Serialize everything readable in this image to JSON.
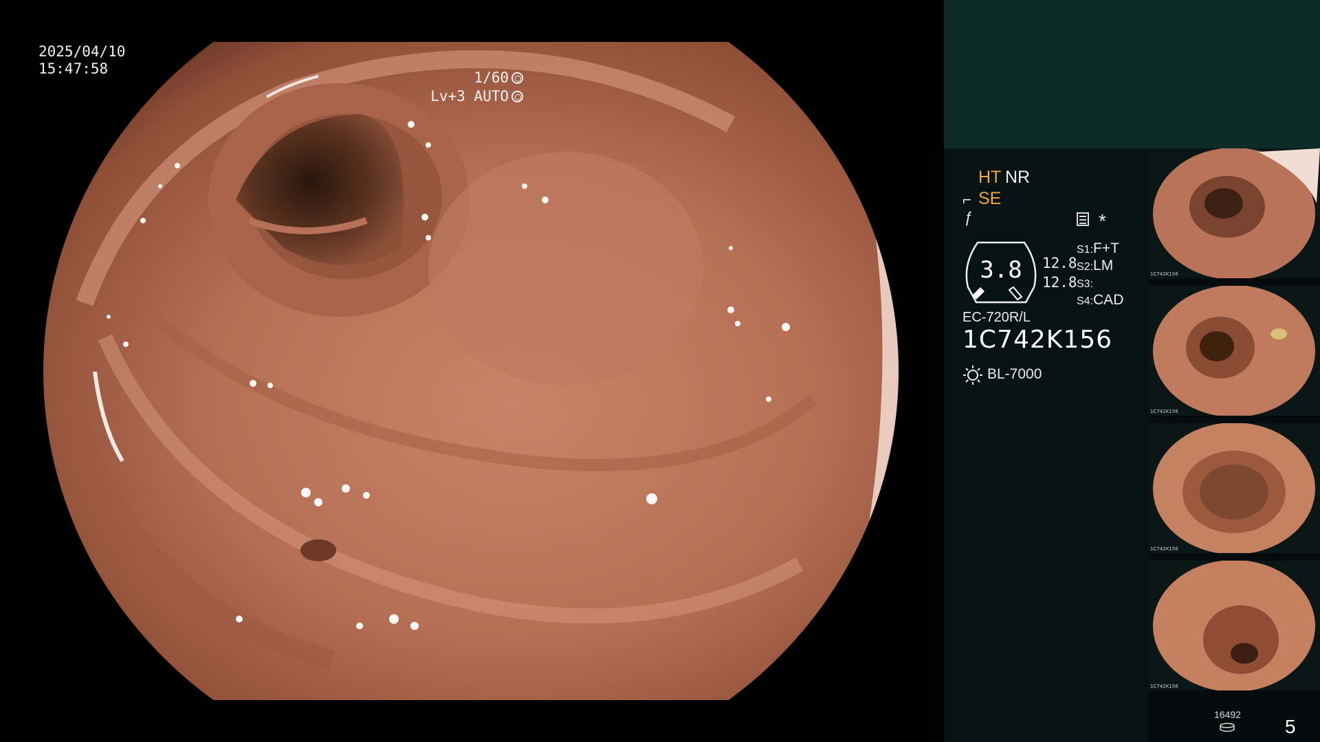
{
  "overlay": {
    "date": "2025/04/10",
    "time": "15:47:58",
    "shutter": "1/60",
    "level": "Lv+3",
    "mode": "AUTO"
  },
  "panel": {
    "ht": "HT",
    "nr": "NR",
    "se": "SE",
    "gauge_value": "3.8",
    "value_a": "12.8",
    "value_b": "12.8",
    "slots": [
      {
        "key": "S1:",
        "value": "F+T"
      },
      {
        "key": "S2:",
        "value": "LM"
      },
      {
        "key": "S3:",
        "value": ""
      },
      {
        "key": "S4:",
        "value": "CAD"
      }
    ],
    "scope_model": "EC-720R/L",
    "scope_serial": "1C742K156",
    "light_source": "BL-7000",
    "frame_count": "16492",
    "page_number": "5",
    "thumbnail_caption": "1C742K156",
    "icons": [
      "scissor-icon",
      "f-stroke-icon",
      "list-icon",
      "asterisk-icon",
      "light-icon",
      "database-icon"
    ]
  },
  "colors": {
    "panel_top": "#0d2a28",
    "panel_bg": "#071212",
    "accent_orange": "#f1a63a"
  }
}
